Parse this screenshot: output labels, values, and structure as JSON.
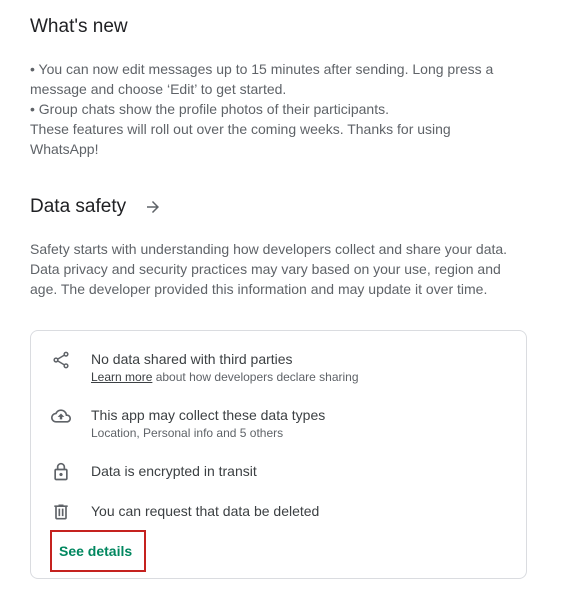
{
  "whats_new": {
    "title": "What's new",
    "lines": [
      "• You can now edit messages up to 15 minutes after sending. Long press a",
      "message and choose ‘Edit’ to get started.",
      "• Group chats show the profile photos of their participants.",
      "These features will roll out over the coming weeks. Thanks for using",
      "WhatsApp!"
    ]
  },
  "data_safety": {
    "title": "Data safety",
    "arrow_icon": "arrow-right-icon",
    "description_lines": [
      "Safety starts with understanding how developers collect and share your data.",
      "Data privacy and security practices may vary based on your use, region and",
      "age. The developer provided this information and may update it over time."
    ],
    "items": [
      {
        "icon": "share-icon",
        "primary": "No data shared with third parties",
        "secondary_link": "Learn more",
        "secondary_rest": " about how developers declare sharing"
      },
      {
        "icon": "cloud-upload-icon",
        "primary": "This app may collect these data types",
        "secondary": "Location, Personal info and 5 others"
      },
      {
        "icon": "lock-icon",
        "primary": "Data is encrypted in transit"
      },
      {
        "icon": "trash-icon",
        "primary": "You can request that data be deleted"
      }
    ],
    "see_details_label": "See details",
    "colors": {
      "link_green": "#01875f",
      "highlight_red": "#c5221f",
      "border": "#dadce0"
    }
  }
}
